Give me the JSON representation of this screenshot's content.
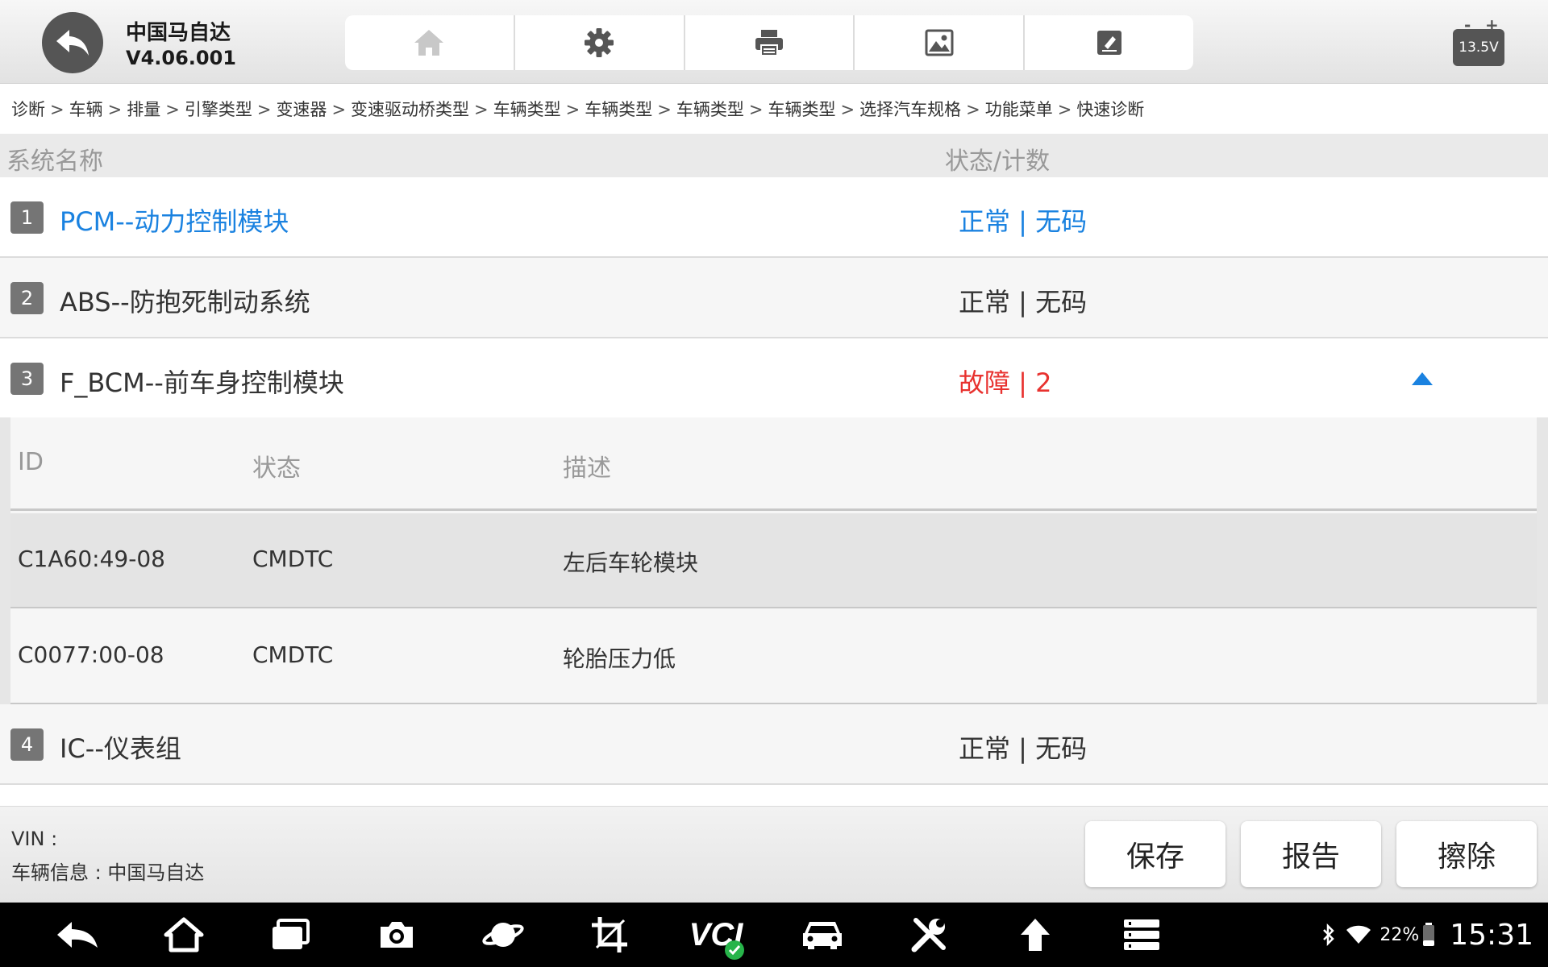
{
  "header": {
    "app_title": "中国马自达",
    "app_version": "V4.06.001",
    "toolbar": [
      "home-icon",
      "gear-icon",
      "printer-icon",
      "image-icon",
      "edit-icon"
    ],
    "battery_voltage": "13.5V",
    "battery_minus": "-",
    "battery_plus": "+"
  },
  "breadcrumb": [
    "诊断",
    "车辆",
    "排量",
    "引擎类型",
    "变速器",
    "变速驱动桥类型",
    "车辆类型",
    "车辆类型",
    "车辆类型",
    "车辆类型",
    "选择汽车规格",
    "功能菜单",
    "快速诊断"
  ],
  "list_header": {
    "system_name": "系统名称",
    "status_count": "状态/计数"
  },
  "systems": [
    {
      "num": "1",
      "name": "PCM--动力控制模块",
      "status": "正常 | 无码",
      "color": "#1a82e0"
    },
    {
      "num": "2",
      "name": "ABS--防抱死制动系统",
      "status": "正常 | 无码"
    },
    {
      "num": "3",
      "name": "F_BCM--前车身控制模块",
      "status": "故障 | 2",
      "status_color": "#e8322f",
      "expanded": true
    },
    {
      "num": "4",
      "name": "IC--仪表组",
      "status": "正常 | 无码"
    }
  ],
  "dtc_table": {
    "headers": {
      "id": "ID",
      "state": "状态",
      "desc": "描述"
    },
    "rows": [
      {
        "id": "C1A60:49-08",
        "state": "CMDTC",
        "desc": "左后车轮模块"
      },
      {
        "id": "C0077:00-08",
        "state": "CMDTC",
        "desc": "轮胎压力低"
      }
    ]
  },
  "info": {
    "vin": "VIN :",
    "vehicle": "车辆信息 : 中国马自达"
  },
  "actions": {
    "save": "保存",
    "report": "报告",
    "erase": "擦除"
  },
  "navbar": {
    "icons": [
      "back-icon",
      "home-icon",
      "recent-apps-icon",
      "camera-icon",
      "planet-icon",
      "crop-icon",
      "vci-icon",
      "car-icon",
      "tools-icon",
      "upload-icon",
      "menu-list-icon"
    ],
    "vci_label": "VCI",
    "battery_pct": "22%",
    "time": "15:31"
  }
}
